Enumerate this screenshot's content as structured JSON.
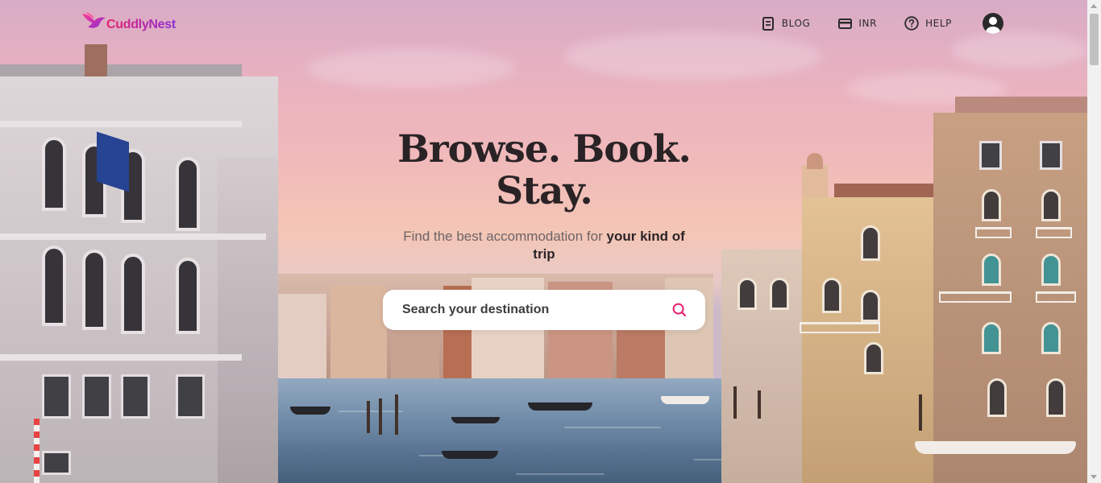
{
  "brand": {
    "name": "CuddlyNest",
    "primary_color": "#e7236f",
    "secondary_color": "#8b2bd6"
  },
  "nav": {
    "items": [
      {
        "label": "BLOG",
        "icon": "document-icon"
      },
      {
        "label": "INR",
        "icon": "credit-card-icon"
      },
      {
        "label": "HELP",
        "icon": "question-circle-icon"
      }
    ],
    "profile_icon": "user-avatar-icon"
  },
  "hero": {
    "title_line1": "Browse. Book.",
    "title_line2": "Stay.",
    "subtitle_plain": "Find the best accommodation for",
    "subtitle_bold": "your kind of trip",
    "background": "Venice Grand Canal at sunset"
  },
  "search": {
    "placeholder": "Search your destination",
    "value": "",
    "icon": "search-icon"
  }
}
